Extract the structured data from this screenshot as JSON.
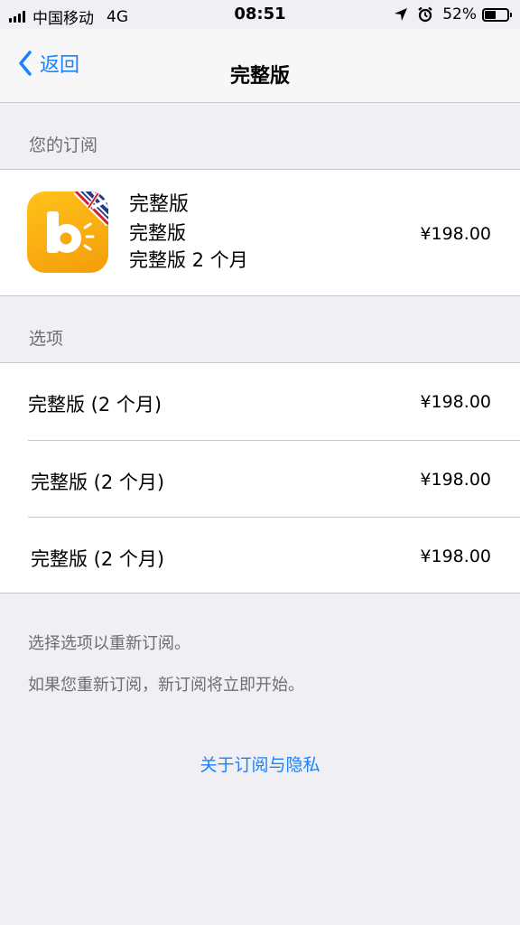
{
  "status_bar": {
    "carrier": "中国移动",
    "network": "4G",
    "time": "08:51",
    "battery_percent": "52%",
    "battery_level": 0.52,
    "icons": [
      "signal-icon",
      "location-arrow-icon",
      "alarm-clock-icon",
      "battery-icon"
    ]
  },
  "nav": {
    "back_label": "返回",
    "title": "完整版"
  },
  "subscription_section": {
    "header": "您的订阅",
    "app_icon": "app-logo-b-with-uk-flag",
    "line1": "完整版",
    "line2": "完整版",
    "line3": "完整版 2 个月",
    "price": "¥198.00"
  },
  "options_section": {
    "header": "选项",
    "items": [
      {
        "label": "完整版 (2 个月)",
        "price": "¥198.00"
      },
      {
        "label": "完整版 (2 个月)",
        "price": "¥198.00"
      },
      {
        "label": "完整版 (2 个月)",
        "price": "¥198.00"
      }
    ]
  },
  "footer": {
    "note1": "选择选项以重新订阅。",
    "note2": "如果您重新订阅，新订阅将立即开始。",
    "privacy_link": "关于订阅与隐私"
  },
  "colors": {
    "accent": "#1a82fb",
    "background": "#efeff4",
    "secondary_text": "#6d6d72",
    "app_icon_orange": "#f7a90f"
  }
}
